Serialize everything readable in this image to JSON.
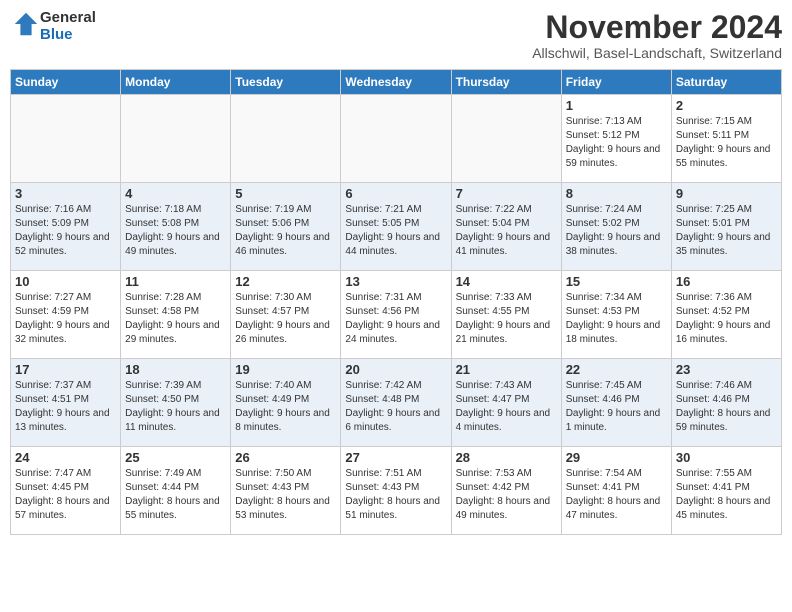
{
  "logo": {
    "general": "General",
    "blue": "Blue"
  },
  "title": "November 2024",
  "subtitle": "Allschwil, Basel-Landschaft, Switzerland",
  "weekdays": [
    "Sunday",
    "Monday",
    "Tuesday",
    "Wednesday",
    "Thursday",
    "Friday",
    "Saturday"
  ],
  "weeks": [
    [
      {
        "day": "",
        "info": ""
      },
      {
        "day": "",
        "info": ""
      },
      {
        "day": "",
        "info": ""
      },
      {
        "day": "",
        "info": ""
      },
      {
        "day": "",
        "info": ""
      },
      {
        "day": "1",
        "info": "Sunrise: 7:13 AM\nSunset: 5:12 PM\nDaylight: 9 hours and 59 minutes."
      },
      {
        "day": "2",
        "info": "Sunrise: 7:15 AM\nSunset: 5:11 PM\nDaylight: 9 hours and 55 minutes."
      }
    ],
    [
      {
        "day": "3",
        "info": "Sunrise: 7:16 AM\nSunset: 5:09 PM\nDaylight: 9 hours and 52 minutes."
      },
      {
        "day": "4",
        "info": "Sunrise: 7:18 AM\nSunset: 5:08 PM\nDaylight: 9 hours and 49 minutes."
      },
      {
        "day": "5",
        "info": "Sunrise: 7:19 AM\nSunset: 5:06 PM\nDaylight: 9 hours and 46 minutes."
      },
      {
        "day": "6",
        "info": "Sunrise: 7:21 AM\nSunset: 5:05 PM\nDaylight: 9 hours and 44 minutes."
      },
      {
        "day": "7",
        "info": "Sunrise: 7:22 AM\nSunset: 5:04 PM\nDaylight: 9 hours and 41 minutes."
      },
      {
        "day": "8",
        "info": "Sunrise: 7:24 AM\nSunset: 5:02 PM\nDaylight: 9 hours and 38 minutes."
      },
      {
        "day": "9",
        "info": "Sunrise: 7:25 AM\nSunset: 5:01 PM\nDaylight: 9 hours and 35 minutes."
      }
    ],
    [
      {
        "day": "10",
        "info": "Sunrise: 7:27 AM\nSunset: 4:59 PM\nDaylight: 9 hours and 32 minutes."
      },
      {
        "day": "11",
        "info": "Sunrise: 7:28 AM\nSunset: 4:58 PM\nDaylight: 9 hours and 29 minutes."
      },
      {
        "day": "12",
        "info": "Sunrise: 7:30 AM\nSunset: 4:57 PM\nDaylight: 9 hours and 26 minutes."
      },
      {
        "day": "13",
        "info": "Sunrise: 7:31 AM\nSunset: 4:56 PM\nDaylight: 9 hours and 24 minutes."
      },
      {
        "day": "14",
        "info": "Sunrise: 7:33 AM\nSunset: 4:55 PM\nDaylight: 9 hours and 21 minutes."
      },
      {
        "day": "15",
        "info": "Sunrise: 7:34 AM\nSunset: 4:53 PM\nDaylight: 9 hours and 18 minutes."
      },
      {
        "day": "16",
        "info": "Sunrise: 7:36 AM\nSunset: 4:52 PM\nDaylight: 9 hours and 16 minutes."
      }
    ],
    [
      {
        "day": "17",
        "info": "Sunrise: 7:37 AM\nSunset: 4:51 PM\nDaylight: 9 hours and 13 minutes."
      },
      {
        "day": "18",
        "info": "Sunrise: 7:39 AM\nSunset: 4:50 PM\nDaylight: 9 hours and 11 minutes."
      },
      {
        "day": "19",
        "info": "Sunrise: 7:40 AM\nSunset: 4:49 PM\nDaylight: 9 hours and 8 minutes."
      },
      {
        "day": "20",
        "info": "Sunrise: 7:42 AM\nSunset: 4:48 PM\nDaylight: 9 hours and 6 minutes."
      },
      {
        "day": "21",
        "info": "Sunrise: 7:43 AM\nSunset: 4:47 PM\nDaylight: 9 hours and 4 minutes."
      },
      {
        "day": "22",
        "info": "Sunrise: 7:45 AM\nSunset: 4:46 PM\nDaylight: 9 hours and 1 minute."
      },
      {
        "day": "23",
        "info": "Sunrise: 7:46 AM\nSunset: 4:46 PM\nDaylight: 8 hours and 59 minutes."
      }
    ],
    [
      {
        "day": "24",
        "info": "Sunrise: 7:47 AM\nSunset: 4:45 PM\nDaylight: 8 hours and 57 minutes."
      },
      {
        "day": "25",
        "info": "Sunrise: 7:49 AM\nSunset: 4:44 PM\nDaylight: 8 hours and 55 minutes."
      },
      {
        "day": "26",
        "info": "Sunrise: 7:50 AM\nSunset: 4:43 PM\nDaylight: 8 hours and 53 minutes."
      },
      {
        "day": "27",
        "info": "Sunrise: 7:51 AM\nSunset: 4:43 PM\nDaylight: 8 hours and 51 minutes."
      },
      {
        "day": "28",
        "info": "Sunrise: 7:53 AM\nSunset: 4:42 PM\nDaylight: 8 hours and 49 minutes."
      },
      {
        "day": "29",
        "info": "Sunrise: 7:54 AM\nSunset: 4:41 PM\nDaylight: 8 hours and 47 minutes."
      },
      {
        "day": "30",
        "info": "Sunrise: 7:55 AM\nSunset: 4:41 PM\nDaylight: 8 hours and 45 minutes."
      }
    ]
  ]
}
